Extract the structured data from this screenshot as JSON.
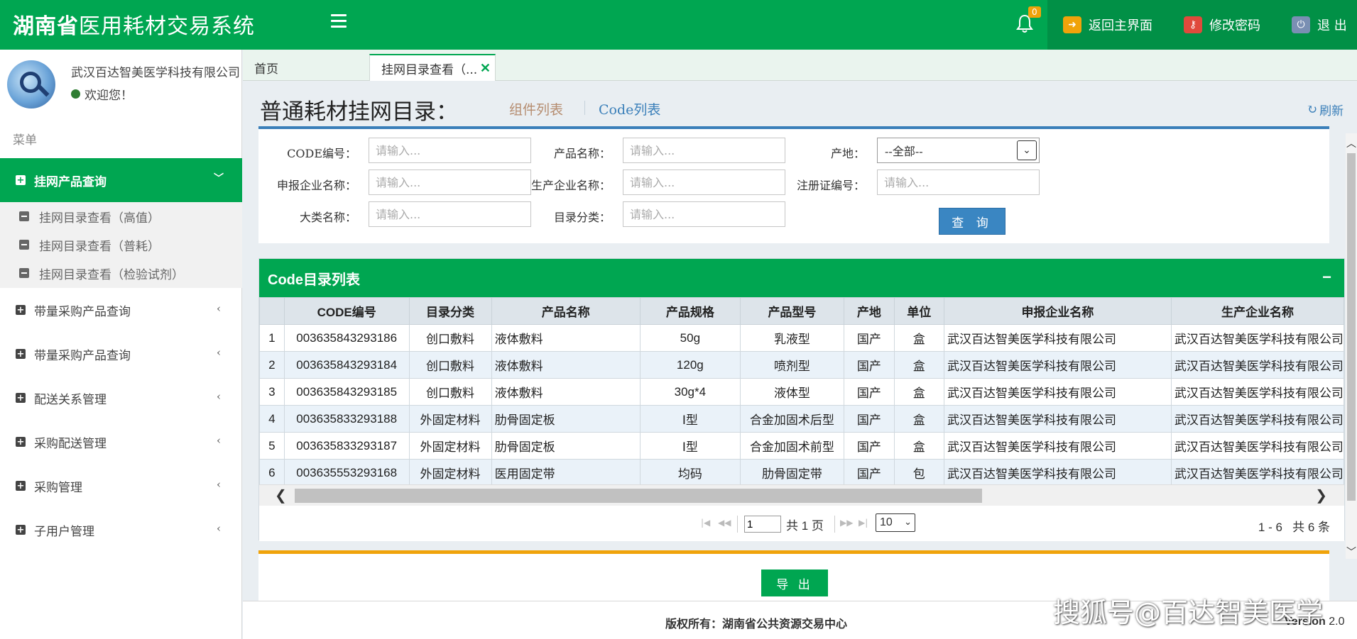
{
  "header": {
    "title_bold": "湖南省",
    "title_rest": "医用耗材交易系统",
    "notification_count": "0",
    "actions": [
      {
        "label": "返回主界面",
        "icon": "return-icon",
        "color": "#f0a30a"
      },
      {
        "label": "修改密码",
        "icon": "key-icon",
        "color": "#e04a3c"
      },
      {
        "label": "退 出",
        "icon": "power-icon",
        "color": "#7a8fb3"
      }
    ]
  },
  "sidebar": {
    "user_name": "武汉百达智美医学科技有限公司",
    "welcome": "欢迎您！",
    "menu_label": "菜单",
    "active_menu": "挂网产品查询",
    "sub_items": [
      "挂网目录查看（高值）",
      "挂网目录查看（普耗）",
      "挂网目录查看（检验试剂）"
    ],
    "menu_items": [
      "带量采购产品查询",
      "带量采购产品查询",
      "配送关系管理",
      "采购配送管理",
      "采购管理",
      "子用户管理"
    ]
  },
  "tabs": {
    "home": "首页",
    "active": "挂网目录查看（..."
  },
  "page": {
    "title": "普通耗材挂网目录：",
    "sub_tab_1": "组件列表",
    "sub_tab_2": "Code列表",
    "refresh": "刷新"
  },
  "search": {
    "code_label": "CODE编号：",
    "product_name_label": "产品名称：",
    "origin_label": "产地：",
    "declare_company_label": "申报企业名称：",
    "manufacturer_label": "生产企业名称：",
    "register_no_label": "注册证编号：",
    "category_label": "大类名称：",
    "catalog_label": "目录分类：",
    "placeholder": "请输入...",
    "origin_value": "--全部--",
    "query_button": "查 询"
  },
  "table": {
    "panel_title": "Code目录列表",
    "columns": [
      "",
      "CODE编号",
      "目录分类",
      "产品名称",
      "产品规格",
      "产品型号",
      "产地",
      "单位",
      "申报企业名称",
      "生产企业名称"
    ],
    "rows": [
      [
        "1",
        "003635843293186",
        "创口敷料",
        "液体敷料",
        "50g",
        "乳液型",
        "国产",
        "盒",
        "武汉百达智美医学科技有限公司",
        "武汉百达智美医学科技有限公司"
      ],
      [
        "2",
        "003635843293184",
        "创口敷料",
        "液体敷料",
        "120g",
        "喷剂型",
        "国产",
        "盒",
        "武汉百达智美医学科技有限公司",
        "武汉百达智美医学科技有限公司"
      ],
      [
        "3",
        "003635843293185",
        "创口敷料",
        "液体敷料",
        "30g*4",
        "液体型",
        "国产",
        "盒",
        "武汉百达智美医学科技有限公司",
        "武汉百达智美医学科技有限公司"
      ],
      [
        "4",
        "003635833293188",
        "外固定材料",
        "肋骨固定板",
        "Ⅰ型",
        "合金加固术后型",
        "国产",
        "盒",
        "武汉百达智美医学科技有限公司",
        "武汉百达智美医学科技有限公司"
      ],
      [
        "5",
        "003635833293187",
        "外固定材料",
        "肋骨固定板",
        "Ⅰ型",
        "合金加固术前型",
        "国产",
        "盒",
        "武汉百达智美医学科技有限公司",
        "武汉百达智美医学科技有限公司"
      ],
      [
        "6",
        "003635553293168",
        "外固定材料",
        "医用固定带",
        "均码",
        "肋骨固定带",
        "国产",
        "包",
        "武汉百达智美医学科技有限公司",
        "武汉百达智美医学科技有限公司"
      ]
    ]
  },
  "pager": {
    "page_value": "1",
    "total_pages": "共 1 页",
    "page_size": "10",
    "range": "1 - 6",
    "total": "共 6 条"
  },
  "export_button": "导 出",
  "footer": {
    "copyright": "版权所有：湖南省公共资源交易中心",
    "version_bold": "Version",
    "version_num": "2.0"
  },
  "watermark": "搜狐号@百达智美医学",
  "colors": {
    "brand_green": "#00a651",
    "blue": "#3a7fb9",
    "orange": "#f0a30a"
  }
}
